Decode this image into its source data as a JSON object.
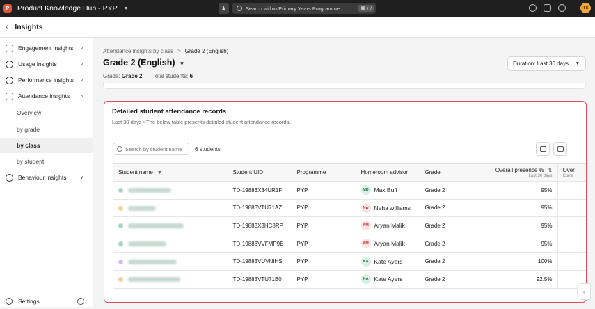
{
  "topbar": {
    "app_title": "Product Knowledge Hub - PYP",
    "logo_letter": "P",
    "search_placeholder": "Search within Primary Years Programme...",
    "search_kbd": "⌘ + /",
    "avatar_initials": "TS",
    "icons": [
      "bulb-icon",
      "calendar-icon",
      "bell-icon"
    ]
  },
  "subbar": {
    "back_glyph": "‹",
    "title": "Insights"
  },
  "sidebar": {
    "items": [
      {
        "label": "Engagement insights",
        "expanded": false
      },
      {
        "label": "Usage insights",
        "expanded": false
      },
      {
        "label": "Performance insights",
        "expanded": false
      },
      {
        "label": "Attendance insights",
        "expanded": true
      }
    ],
    "attendance_sub": [
      {
        "label": "Overview",
        "active": false
      },
      {
        "label": "by grade",
        "active": false
      },
      {
        "label": "by class",
        "active": true
      },
      {
        "label": "by student",
        "active": false
      }
    ],
    "behaviour": {
      "label": "Behaviour insights"
    },
    "settings": {
      "label": "Settings"
    }
  },
  "main": {
    "breadcrumb": {
      "parent": "Attendance insights by class",
      "sep": ">",
      "current": "Grade 2 (English)"
    },
    "page_title": "Grade 2 (English)",
    "meta": {
      "grade_label": "Grade:",
      "grade_value": "Grade 2",
      "students_label": "Total students:",
      "students_value": "6"
    },
    "duration": {
      "label": "Duration:",
      "value": "Last 30 days"
    }
  },
  "card": {
    "title": "Detailed student attendance records",
    "subtitle": "Last 30 days  •  The below table presents detailed student attendance records.",
    "search_placeholder": "Search by student name",
    "count": "6 students",
    "columns": {
      "name": "Student name",
      "uid": "Student UID",
      "programme": "Programme",
      "advisor": "Homeroom advisor",
      "grade": "Grade",
      "presence": "Overall presence %",
      "presence_sub": "Last 30 days",
      "overflow": "Over",
      "overflow_sub": "Curre"
    },
    "rows": [
      {
        "uid": "TD-19883X34UR1F",
        "programme": "PYP",
        "advisor_initials": "MB",
        "advisor": "Max Buff",
        "advisor_bg": "#d8f0e4",
        "advisor_fg": "#2e7d52",
        "grade": "Grade 2",
        "presence": "95%",
        "name_dot": "#a6d4bf",
        "name_w": 0.62
      },
      {
        "uid": "TD-19883VTU71AZ",
        "programme": "PYP",
        "advisor_initials": "Nw",
        "advisor": "Neha williams",
        "advisor_bg": "#fde2e2",
        "advisor_fg": "#c0474a",
        "grade": "Grade 2",
        "presence": "95%",
        "name_dot": "#f2cf8e",
        "name_w": 0.4
      },
      {
        "uid": "TD-19883X3HC8RP",
        "programme": "PYP",
        "advisor_initials": "AM",
        "advisor": "Aryan Malik",
        "advisor_bg": "#fde2e2",
        "advisor_fg": "#c0474a",
        "grade": "Grade 2",
        "presence": "95%",
        "name_dot": "#a6d4bf",
        "name_w": 0.8
      },
      {
        "uid": "TD-19883VVFMP9E",
        "programme": "PYP",
        "advisor_initials": "AM",
        "advisor": "Aryan Malik",
        "advisor_bg": "#fde2e2",
        "advisor_fg": "#c0474a",
        "grade": "Grade 2",
        "presence": "95%",
        "name_dot": "#a6d4bf",
        "name_w": 0.55
      },
      {
        "uid": "TD-19883VUVNIHS",
        "programme": "PYP",
        "advisor_initials": "KA",
        "advisor": "Kate Ayers",
        "advisor_bg": "#d8f0e4",
        "advisor_fg": "#2e7d52",
        "grade": "Grade 2",
        "presence": "100%",
        "name_dot": "#d8b9f2",
        "name_w": 0.7
      },
      {
        "uid": "TD-19883VTU71B0",
        "programme": "PYP",
        "advisor_initials": "KA",
        "advisor": "Kate Ayers",
        "advisor_bg": "#d8f0e4",
        "advisor_fg": "#2e7d52",
        "grade": "Grade 2",
        "presence": "92.5%",
        "name_dot": "#f2cf8e",
        "name_w": 0.75
      }
    ]
  },
  "colors": {
    "accent_border": "#e04a5a",
    "topbar": "#1f1f1f",
    "logo": "#e8533c"
  }
}
